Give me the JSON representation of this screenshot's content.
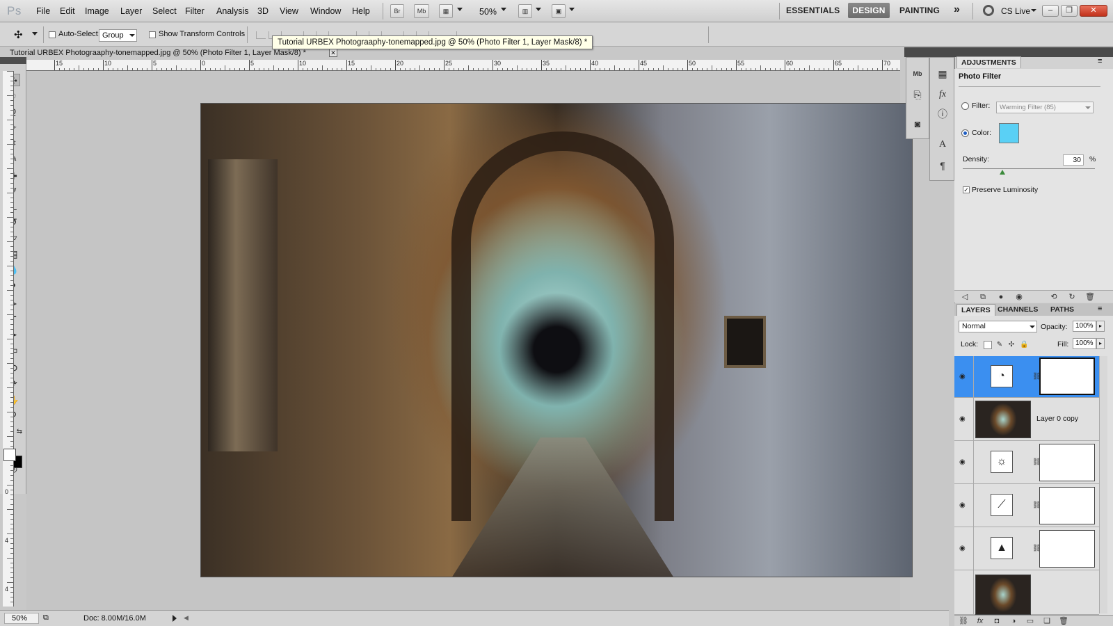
{
  "app": {
    "logo": "Ps"
  },
  "menu": [
    "File",
    "Edit",
    "Image",
    "Layer",
    "Select",
    "Filter",
    "Analysis",
    "3D",
    "View",
    "Window",
    "Help"
  ],
  "appbar": {
    "bridge": "Br",
    "minibridge": "Mb",
    "zoom": "50%"
  },
  "workspaces": {
    "essentials": "ESSENTIALS",
    "design": "DESIGN",
    "painting": "PAINTING",
    "more": "»",
    "cslive": "CS Live"
  },
  "window_controls": {
    "minimize": "–",
    "restore": "❐",
    "close": "✕"
  },
  "options": {
    "auto_select_label": "Auto-Select:",
    "auto_select_value": "Group",
    "transform_label": "Show Transform Controls"
  },
  "document": {
    "tab_title": "Tutorial URBEX Photograaphy-tonemapped.jpg @ 50% (Photo Filter 1, Layer Mask/8) *",
    "tooltip": "Tutorial URBEX Photograaphy-tonemapped.jpg @ 50% (Photo Filter 1, Layer Mask/8) *"
  },
  "rulers": {
    "horizontal": [
      "15",
      "10",
      "5",
      "0",
      "5",
      "10",
      "15",
      "20",
      "25",
      "30",
      "35",
      "40",
      "45",
      "50",
      "55",
      "60",
      "65",
      "70"
    ],
    "vertical": [
      "0",
      "4",
      "4",
      "5"
    ]
  },
  "status": {
    "zoom": "50%",
    "doc_size": "Doc: 8.00M/16.0M"
  },
  "adjustments": {
    "tab_label": "ADJUSTMENTS",
    "title": "Photo Filter",
    "filter_label": "Filter:",
    "filter_value": "Warming Filter (85)",
    "color_label": "Color:",
    "color_value": "#5ad0f5",
    "density_label": "Density:",
    "density_value": "30",
    "density_unit": "%",
    "preserve_label": "Preserve Luminosity"
  },
  "layers_panel": {
    "tabs": [
      "LAYERS",
      "CHANNELS",
      "PATHS"
    ],
    "blend_mode": "Normal",
    "opacity_label": "Opacity:",
    "opacity_value": "100%",
    "lock_label": "Lock:",
    "fill_label": "Fill:",
    "fill_value": "100%",
    "layers": [
      {
        "type": "photo-filter-adjustment",
        "selected": true
      },
      {
        "type": "image",
        "name": "Layer 0 copy"
      },
      {
        "type": "brightness-adjustment"
      },
      {
        "type": "curves-adjustment"
      },
      {
        "type": "levels-adjustment"
      }
    ]
  }
}
